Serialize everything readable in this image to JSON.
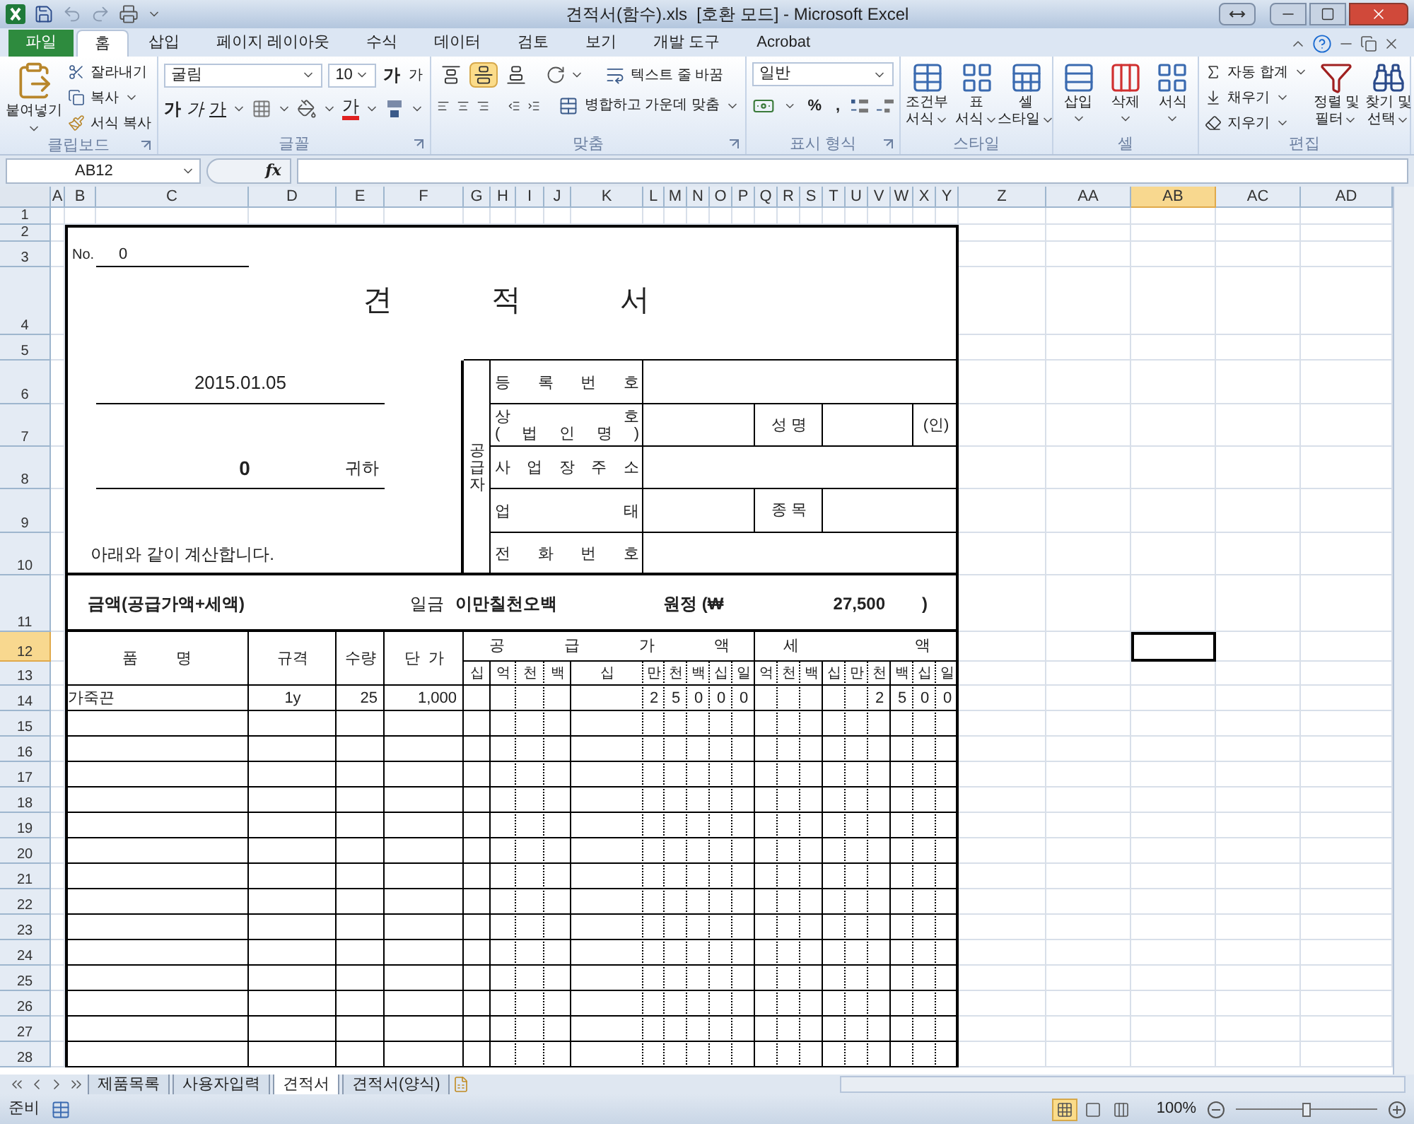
{
  "window": {
    "title": "견적서(함수).xls  [호환 모드] - Microsoft Excel"
  },
  "ribbon_tabs": [
    {
      "label": "파일",
      "kind": "file",
      "selected": false
    },
    {
      "label": "홈",
      "kind": "tab",
      "selected": true
    },
    {
      "label": "삽입",
      "kind": "tab",
      "selected": false
    },
    {
      "label": "페이지 레이아웃",
      "kind": "tab",
      "selected": false
    },
    {
      "label": "수식",
      "kind": "tab",
      "selected": false
    },
    {
      "label": "데이터",
      "kind": "tab",
      "selected": false
    },
    {
      "label": "검토",
      "kind": "tab",
      "selected": false
    },
    {
      "label": "보기",
      "kind": "tab",
      "selected": false
    },
    {
      "label": "개발 도구",
      "kind": "tab",
      "selected": false
    },
    {
      "label": "Acrobat",
      "kind": "tab",
      "selected": false
    }
  ],
  "ribbon_groups": [
    {
      "kind": "clipboard",
      "title": "클립보드",
      "paste": "붙여넣기",
      "small": [
        "잘라내기",
        "복사",
        "서식 복사"
      ]
    },
    {
      "kind": "font",
      "title": "글꼴",
      "font": "굴림",
      "size": "10",
      "resize": [
        "가",
        "가"
      ],
      "styles": [
        "가",
        "가",
        "가"
      ],
      "color_button": "가"
    },
    {
      "kind": "alignment",
      "title": "맞춤",
      "valign": [
        {
          "selected": false
        },
        {
          "selected": true
        },
        {
          "selected": false
        }
      ],
      "wrap": "텍스트 줄 바꿈",
      "merge": "병합하고 가운데 맞춤"
    },
    {
      "kind": "number",
      "title": "표시 형식",
      "format": "일반",
      "symbols": [
        "%",
        ","
      ]
    },
    {
      "kind": "styles",
      "title": "스타일",
      "buttons": [
        [
          "조건부",
          "서식"
        ],
        [
          "표",
          "서식"
        ],
        [
          "셀",
          "스타일"
        ]
      ]
    },
    {
      "kind": "cells",
      "title": "셀",
      "buttons": [
        "삽입",
        "삭제",
        "서식"
      ]
    },
    {
      "kind": "editing",
      "title": "편집",
      "small": [
        "자동 합계",
        "채우기",
        "지우기"
      ],
      "large": [
        [
          "정렬 및",
          "필터"
        ],
        [
          "찾기 및",
          "선택"
        ]
      ]
    }
  ],
  "formula_bar": {
    "name_box": "AB12",
    "function_label": "fx"
  },
  "columns": [
    {
      "label": "A",
      "selected": false
    },
    {
      "label": "B",
      "selected": false
    },
    {
      "label": "C",
      "selected": false
    },
    {
      "label": "D",
      "selected": false
    },
    {
      "label": "E",
      "selected": false
    },
    {
      "label": "F",
      "selected": false
    },
    {
      "label": "G",
      "selected": false
    },
    {
      "label": "H",
      "selected": false
    },
    {
      "label": "I",
      "selected": false
    },
    {
      "label": "J",
      "selected": false
    },
    {
      "label": "K",
      "selected": false
    },
    {
      "label": "L",
      "selected": false
    },
    {
      "label": "M",
      "selected": false
    },
    {
      "label": "N",
      "selected": false
    },
    {
      "label": "O",
      "selected": false
    },
    {
      "label": "P",
      "selected": false
    },
    {
      "label": "Q",
      "selected": false
    },
    {
      "label": "R",
      "selected": false
    },
    {
      "label": "S",
      "selected": false
    },
    {
      "label": "T",
      "selected": false
    },
    {
      "label": "U",
      "selected": false
    },
    {
      "label": "V",
      "selected": false
    },
    {
      "label": "W",
      "selected": false
    },
    {
      "label": "X",
      "selected": false
    },
    {
      "label": "Y",
      "selected": false
    },
    {
      "label": "Z",
      "selected": false
    },
    {
      "label": "AA",
      "selected": false
    },
    {
      "label": "AB",
      "selected": true
    },
    {
      "label": "AC",
      "selected": false
    },
    {
      "label": "AD",
      "selected": false
    }
  ],
  "rows": [
    {
      "label": "1",
      "selected": false
    },
    {
      "label": "2",
      "selected": false
    },
    {
      "label": "3",
      "selected": false
    },
    {
      "label": "4",
      "selected": false
    },
    {
      "label": "5",
      "selected": false
    },
    {
      "label": "6",
      "selected": false
    },
    {
      "label": "7",
      "selected": false
    },
    {
      "label": "8",
      "selected": false
    },
    {
      "label": "9",
      "selected": false
    },
    {
      "label": "10",
      "selected": false
    },
    {
      "label": "11",
      "selected": false
    },
    {
      "label": "12",
      "selected": true
    },
    {
      "label": "13",
      "selected": false
    },
    {
      "label": "14",
      "selected": false
    },
    {
      "label": "15",
      "selected": false
    },
    {
      "label": "16",
      "selected": false
    },
    {
      "label": "17",
      "selected": false
    },
    {
      "label": "18",
      "selected": false
    },
    {
      "label": "19",
      "selected": false
    },
    {
      "label": "20",
      "selected": false
    },
    {
      "label": "21",
      "selected": false
    },
    {
      "label": "22",
      "selected": false
    },
    {
      "label": "23",
      "selected": false
    },
    {
      "label": "24",
      "selected": false
    },
    {
      "label": "25",
      "selected": false
    },
    {
      "label": "26",
      "selected": false
    },
    {
      "label": "27",
      "selected": false
    },
    {
      "label": "28",
      "selected": false
    }
  ],
  "quote": {
    "no_label": "No.",
    "no_value": "0",
    "title": "견 적 서",
    "date": "2015.01.05",
    "recipient": "0",
    "honorific": "귀하",
    "intro": "아래와 같이 계산합니다.",
    "supplier": {
      "label": "공급자",
      "rows": [
        {
          "kind": "single",
          "label": [
            "등 록 번 호"
          ]
        },
        {
          "kind": "name",
          "label": [
            "상 호",
            "( 법 인 명 )"
          ],
          "field": "성 명",
          "seal": "(인)"
        },
        {
          "kind": "single",
          "label": [
            "사 업 장 주 소"
          ]
        },
        {
          "kind": "type",
          "label": [
            "업 태"
          ],
          "field": "종 목"
        },
        {
          "kind": "single",
          "label": [
            "전 화 번 호"
          ]
        }
      ]
    },
    "amount": {
      "label": "금액(공급가액+세액)",
      "prefix": "일금",
      "words": "이만칠천오백",
      "won": "원정 (₩",
      "value": "27,500",
      "close": ")"
    },
    "table": {
      "columns": [
        "품 명",
        "규격",
        "수량",
        "단 가"
      ],
      "supply_header": "공 급 가 액",
      "tax_header": "세 액",
      "supply_digits": [
        "십",
        "억",
        "천",
        "백",
        "십",
        "만",
        "천",
        "백",
        "십",
        "일"
      ],
      "tax_digits": [
        "억",
        "천",
        "백",
        "십",
        "만",
        "천",
        "백",
        "십",
        "일"
      ],
      "items": [
        {
          "name": "가죽끈",
          "spec": "1y",
          "qty": "25",
          "price": "1,000",
          "supply": [
            "2",
            "5",
            "0",
            "0",
            "0"
          ],
          "tax": [
            "2",
            "5",
            "0",
            "0"
          ]
        }
      ]
    }
  },
  "sheet_tabs": [
    {
      "label": "제품목록",
      "selected": false
    },
    {
      "label": "사용자입력",
      "selected": false
    },
    {
      "label": "견적서",
      "selected": true
    },
    {
      "label": "견적서(양식)",
      "selected": false
    }
  ],
  "status_bar": {
    "state": "준비",
    "views": [
      {
        "selected": true
      },
      {
        "selected": false
      },
      {
        "selected": false
      }
    ],
    "zoom": {
      "label": "100%",
      "level": 0.5
    }
  }
}
